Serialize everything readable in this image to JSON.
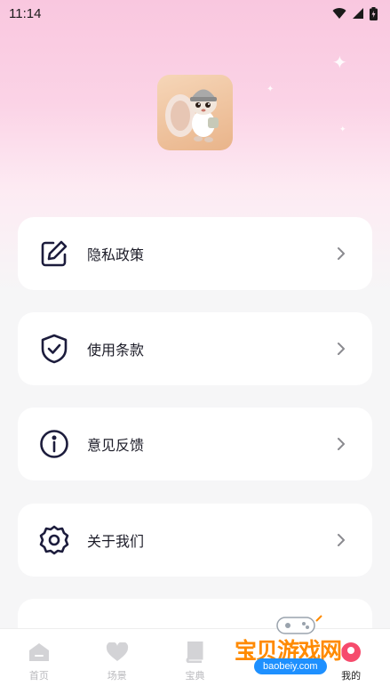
{
  "status_bar": {
    "time": "11:14"
  },
  "menu": [
    {
      "label": "隐私政策",
      "icon": "edit-icon"
    },
    {
      "label": "使用条款",
      "icon": "shield-check-icon"
    },
    {
      "label": "意见反馈",
      "icon": "info-icon"
    },
    {
      "label": "关于我们",
      "icon": "gear-icon"
    }
  ],
  "bottom_nav": [
    {
      "label": "首页",
      "icon": "home-icon",
      "active": false
    },
    {
      "label": "场景",
      "icon": "heart-icon",
      "active": false
    },
    {
      "label": "宝典",
      "icon": "book-icon",
      "active": false
    },
    {
      "label": "",
      "icon": "tab-icon",
      "active": false
    },
    {
      "label": "我的",
      "icon": "profile-icon",
      "active": true
    }
  ],
  "watermark": {
    "brand": "宝贝游戏网",
    "url": "baobeiy.com"
  },
  "colors": {
    "accent_pink": "#f9c7df",
    "icon_navy": "#1c1c3c",
    "inactive_gray": "#b9b9bd"
  }
}
